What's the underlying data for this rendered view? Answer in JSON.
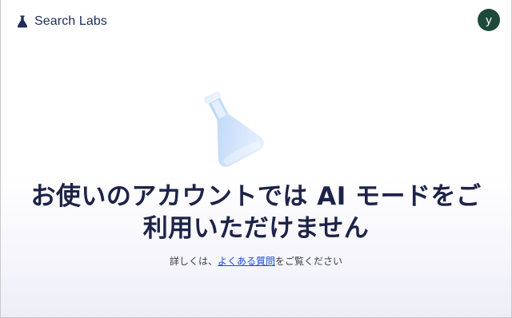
{
  "header": {
    "brand_name": "Search Labs",
    "brand_icon": "flask-icon"
  },
  "avatar": {
    "initial": "y",
    "color": "#1e4a3c"
  },
  "main": {
    "hero_icon": "flask-illustration",
    "title_line1": "お使いのアカウントでは AI モードをご",
    "title_line2": "利用いただけません",
    "help_prefix": "詳しくは、",
    "help_link": "よくある質問",
    "help_suffix": "をご覧ください"
  },
  "colors": {
    "title": "#1d2348",
    "link": "#1a4fd6",
    "brand": "#1f2b5a"
  }
}
